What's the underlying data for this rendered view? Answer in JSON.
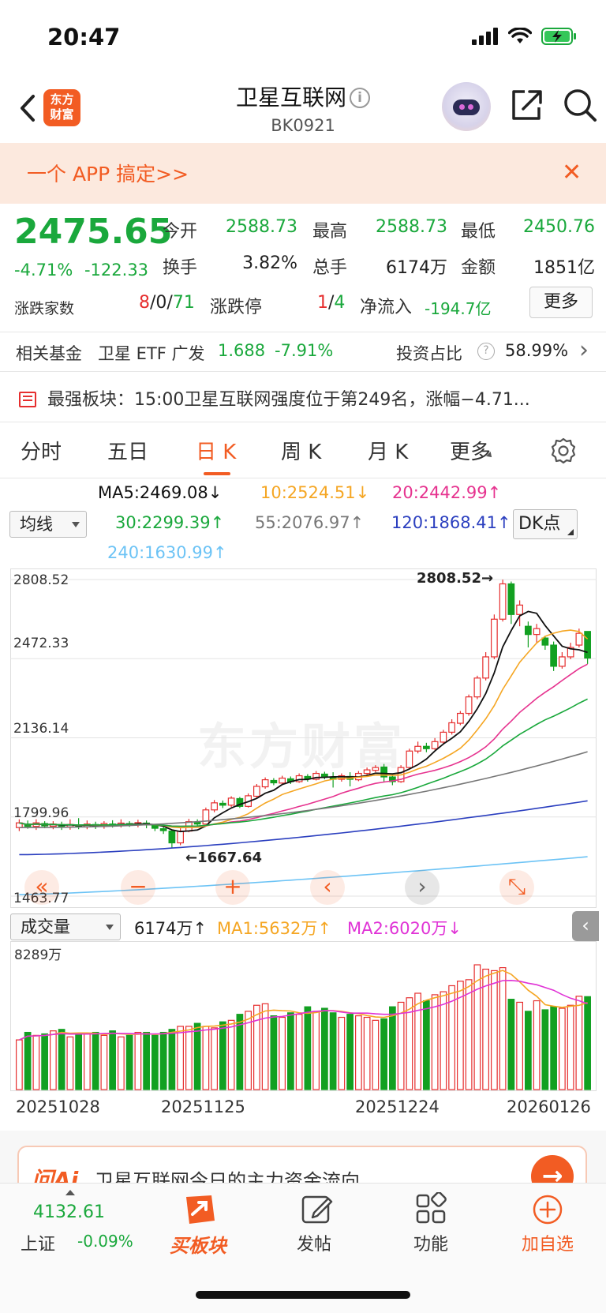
{
  "status_bar": {
    "time": "20:47"
  },
  "header": {
    "logo_text_line1": "东方",
    "logo_text_line2": "财富",
    "title": "卫星互联网",
    "info_symbol": "i",
    "code": "BK0921"
  },
  "banner": {
    "text": "一个 APP 搞定>>",
    "close": "✕"
  },
  "quote": {
    "price": "2475.65",
    "change_pct": "-4.71%",
    "change_abs": "-122.33",
    "rows": [
      [
        {
          "label": "今开",
          "value": "2588.73",
          "color": "green"
        },
        {
          "label": "最高",
          "value": "2588.73",
          "color": "green"
        },
        {
          "label": "最低",
          "value": "2450.76",
          "color": "green"
        }
      ],
      [
        {
          "label": "换手",
          "value": "3.82%",
          "color": "dark"
        },
        {
          "label": "总手",
          "value": "6174万",
          "color": "dark"
        },
        {
          "label": "金额",
          "value": "1851亿",
          "color": "dark"
        }
      ]
    ],
    "breadth_label": "涨跌家数",
    "breadth_up": "8",
    "breadth_sep1": "/",
    "breadth_flat": "0",
    "breadth_sep2": "/",
    "breadth_down": "71",
    "limit_label": "涨跌停",
    "limit_up": "1",
    "limit_sep": "/",
    "limit_down": "4",
    "net_inflow_label": "净流入",
    "net_inflow_value": "-194.7亿",
    "more_button": "更多"
  },
  "fund_row": {
    "label": "相关基金",
    "fund_name": "卫星 ETF 广发",
    "fund_price": "1.688",
    "fund_change": "-7.91%",
    "ratio_label": "投资占比",
    "ratio_help": "?",
    "ratio_value": "58.99%",
    "chevron": "›"
  },
  "rank_row": {
    "text": "最强板块：15:00卫星互联网强度位于第249名，涨幅−4.71..."
  },
  "tabs": [
    {
      "label": "分时",
      "active": false
    },
    {
      "label": "五日",
      "active": false
    },
    {
      "label": "日 K",
      "active": true
    },
    {
      "label": "周 K",
      "active": false
    },
    {
      "label": "月 K",
      "active": false
    },
    {
      "label": "更多",
      "active": false
    }
  ],
  "ma_legend": {
    "selector": "均线",
    "ma5": "MA5:2469.08↓",
    "ma10": "10:2524.51↓",
    "ma20": "20:2442.99↑",
    "ma30": "30:2299.39↑",
    "ma55": "55:2076.97↑",
    "ma120": "120:1868.41↑",
    "ma240": "240:1630.99↑",
    "dk_button": "DK点",
    "colors": {
      "ma5": "#111111",
      "ma10": "#f5a623",
      "ma20": "#e6338f",
      "ma30": "#1aa83c",
      "ma55": "#777777",
      "ma120": "#2b3fbf",
      "ma240": "#6cc3f5"
    }
  },
  "price_axis": [
    "2808.52",
    "2472.33",
    "2136.14",
    "1799.96",
    "1463.77"
  ],
  "annotations": {
    "high": "2808.52→",
    "low": "←1667.64"
  },
  "watermark": "东方财富",
  "chart_controls": [
    "«",
    "−",
    "+",
    "‹",
    "›",
    "⤡"
  ],
  "volume": {
    "selector": "成交量",
    "current": "6174万↑",
    "ma1": "MA1:5632万↑",
    "ma2": "MA2:6020万↓",
    "axis_top": "8289万"
  },
  "x_dates": [
    "20251028",
    "20251125",
    "20251224",
    "20260126"
  ],
  "ai_card": {
    "logo": "问Ai",
    "text": "卫星互联网今日的主力资金流向",
    "arrow": "→"
  },
  "bottom_nav": {
    "index_value": "4132.61",
    "index_name": "上证",
    "index_change": "-0.09%",
    "items": [
      "买板块",
      "发帖",
      "功能",
      "加自选"
    ]
  },
  "chart_data": {
    "type": "candlestick",
    "title": "",
    "price_ticks": [
      2808.52,
      2472.33,
      2136.14,
      1799.96,
      1463.77
    ],
    "ylim": [
      1463.77,
      2808.52
    ],
    "high_label": 2808.52,
    "low_label": 1667.64,
    "candles": [
      [
        1755,
        1775,
        1740,
        1790
      ],
      [
        1770,
        1760,
        1750,
        1785
      ],
      [
        1760,
        1775,
        1745,
        1790
      ],
      [
        1772,
        1762,
        1752,
        1782
      ],
      [
        1760,
        1770,
        1748,
        1782
      ],
      [
        1768,
        1758,
        1745,
        1780
      ],
      [
        1758,
        1768,
        1746,
        1790
      ],
      [
        1766,
        1760,
        1748,
        1795
      ],
      [
        1758,
        1770,
        1748,
        1785
      ],
      [
        1768,
        1760,
        1749,
        1780
      ],
      [
        1760,
        1772,
        1750,
        1782
      ],
      [
        1770,
        1765,
        1755,
        1786
      ],
      [
        1764,
        1774,
        1755,
        1790
      ],
      [
        1772,
        1768,
        1758,
        1782
      ],
      [
        1766,
        1776,
        1756,
        1788
      ],
      [
        1774,
        1766,
        1752,
        1785
      ],
      [
        1762,
        1752,
        1740,
        1770
      ],
      [
        1750,
        1742,
        1728,
        1760
      ],
      [
        1740,
        1690,
        1668,
        1745
      ],
      [
        1690,
        1740,
        1680,
        1752
      ],
      [
        1740,
        1780,
        1735,
        1792
      ],
      [
        1778,
        1770,
        1760,
        1790
      ],
      [
        1770,
        1830,
        1768,
        1840
      ],
      [
        1830,
        1860,
        1820,
        1872
      ],
      [
        1858,
        1850,
        1838,
        1870
      ],
      [
        1850,
        1880,
        1842,
        1888
      ],
      [
        1878,
        1845,
        1838,
        1885
      ],
      [
        1845,
        1890,
        1840,
        1900
      ],
      [
        1888,
        1930,
        1882,
        1940
      ],
      [
        1928,
        1958,
        1920,
        1968
      ],
      [
        1955,
        1945,
        1935,
        1965
      ],
      [
        1944,
        1965,
        1938,
        1975
      ],
      [
        1962,
        1950,
        1940,
        1972
      ],
      [
        1950,
        1975,
        1945,
        1985
      ],
      [
        1972,
        1962,
        1950,
        1982
      ],
      [
        1960,
        1985,
        1955,
        1995
      ],
      [
        1982,
        1970,
        1960,
        1992
      ],
      [
        1968,
        1960,
        1925,
        1990
      ],
      [
        1960,
        1975,
        1950,
        1985
      ],
      [
        1972,
        1960,
        1930,
        1990
      ],
      [
        1958,
        1985,
        1952,
        1995
      ],
      [
        1985,
        2000,
        1978,
        2010
      ],
      [
        1998,
        2010,
        1990,
        2020
      ],
      [
        2012,
        1970,
        1950,
        2025
      ],
      [
        1970,
        1950,
        1935,
        1980
      ],
      [
        1950,
        2010,
        1945,
        2020
      ],
      [
        2010,
        2080,
        2005,
        2090
      ],
      [
        2080,
        2100,
        2070,
        2120
      ],
      [
        2100,
        2090,
        2075,
        2115
      ],
      [
        2090,
        2120,
        2085,
        2135
      ],
      [
        2118,
        2160,
        2110,
        2170
      ],
      [
        2160,
        2200,
        2150,
        2215
      ],
      [
        2198,
        2240,
        2190,
        2250
      ],
      [
        2240,
        2310,
        2230,
        2320
      ],
      [
        2310,
        2390,
        2300,
        2400
      ],
      [
        2390,
        2480,
        2380,
        2500
      ],
      [
        2480,
        2640,
        2470,
        2660
      ],
      [
        2640,
        2790,
        2630,
        2808
      ],
      [
        2790,
        2660,
        2620,
        2800
      ],
      [
        2660,
        2700,
        2610,
        2720
      ],
      [
        2610,
        2575,
        2520,
        2630
      ],
      [
        2575,
        2600,
        2540,
        2620
      ],
      [
        2560,
        2530,
        2510,
        2570
      ],
      [
        2530,
        2440,
        2420,
        2545
      ],
      [
        2440,
        2480,
        2430,
        2500
      ],
      [
        2480,
        2520,
        2470,
        2540
      ],
      [
        2530,
        2580,
        2520,
        2600
      ],
      [
        2588,
        2475,
        2450,
        2588
      ]
    ],
    "volumes": [
      3300,
      3800,
      3600,
      3700,
      3900,
      4000,
      3500,
      3700,
      3700,
      3800,
      3600,
      3900,
      3500,
      3600,
      3800,
      3800,
      3600,
      3800,
      4000,
      4200,
      4200,
      4400,
      4200,
      4100,
      4500,
      4600,
      5000,
      5200,
      5600,
      5700,
      4900,
      4800,
      5100,
      5000,
      5500,
      5200,
      5400,
      5100,
      4800,
      5000,
      4900,
      4800,
      4600,
      4700,
      5500,
      5800,
      6100,
      6400,
      5900,
      6300,
      6500,
      6900,
      7200,
      7300,
      8289,
      8000,
      7900,
      8100,
      6000,
      5800,
      5200,
      5900,
      5300,
      5500,
      5400,
      5600,
      6200,
      6174
    ],
    "vol_ylim": [
      0,
      8289
    ]
  }
}
